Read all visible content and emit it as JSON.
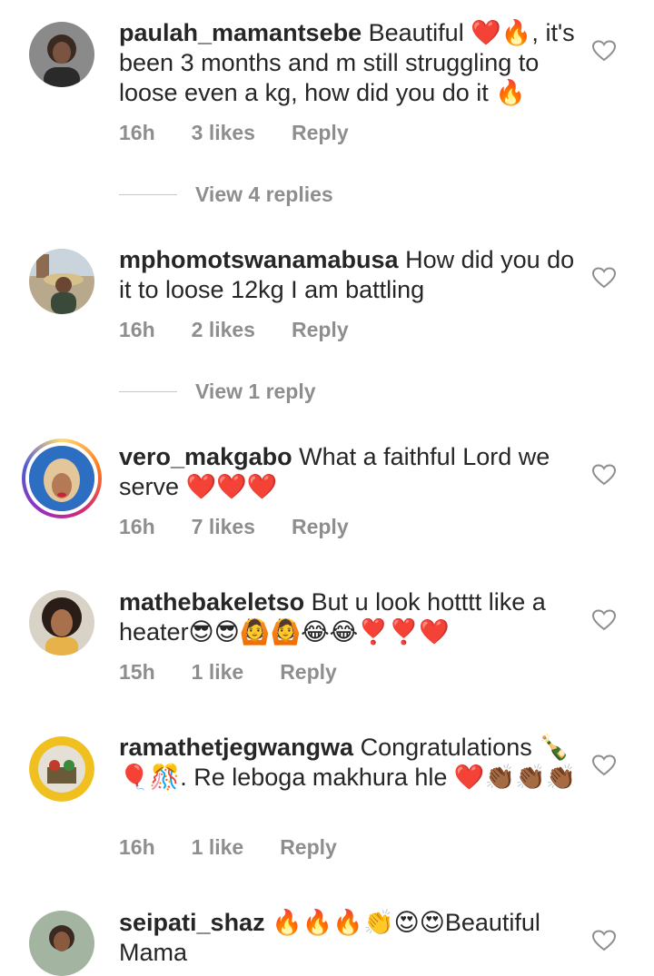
{
  "comments": [
    {
      "username": "paulah_mamantsebe",
      "text": "Beautiful ❤️🔥, it's been 3 months and m still struggling to loose even a kg, how did you do it 🔥",
      "time": "16h",
      "likes": "3 likes",
      "reply": "Reply",
      "view_replies": "View 4 replies"
    },
    {
      "username": "mphomotswanamabusa",
      "text": "How did you do it to loose 12kg I am battling",
      "time": "16h",
      "likes": "2 likes",
      "reply": "Reply",
      "view_replies": "View 1 reply"
    },
    {
      "username": "vero_makgabo",
      "text": "What a faithful Lord we serve ❤️❤️❤️",
      "time": "16h",
      "likes": "7 likes",
      "reply": "Reply"
    },
    {
      "username": "mathebakeletso",
      "text": "But u look hotttt like a heater😎😎🙆🙆😂😂❣️❣️❤️",
      "time": "15h",
      "likes": "1 like",
      "reply": "Reply"
    },
    {
      "username": "ramathetjegwangwa",
      "text": "Congratulations 🍾🎈🎊. Re leboga makhura hle ❤️👏🏾👏🏾👏🏾",
      "time": "16h",
      "likes": "1 like",
      "reply": "Reply"
    },
    {
      "username": "seipati_shaz",
      "text": "🔥🔥🔥👏😍😍Beautiful Mama"
    }
  ],
  "colors": {
    "text": "#262626",
    "meta": "#8e8e8e",
    "heart_red": "#ed4956"
  }
}
